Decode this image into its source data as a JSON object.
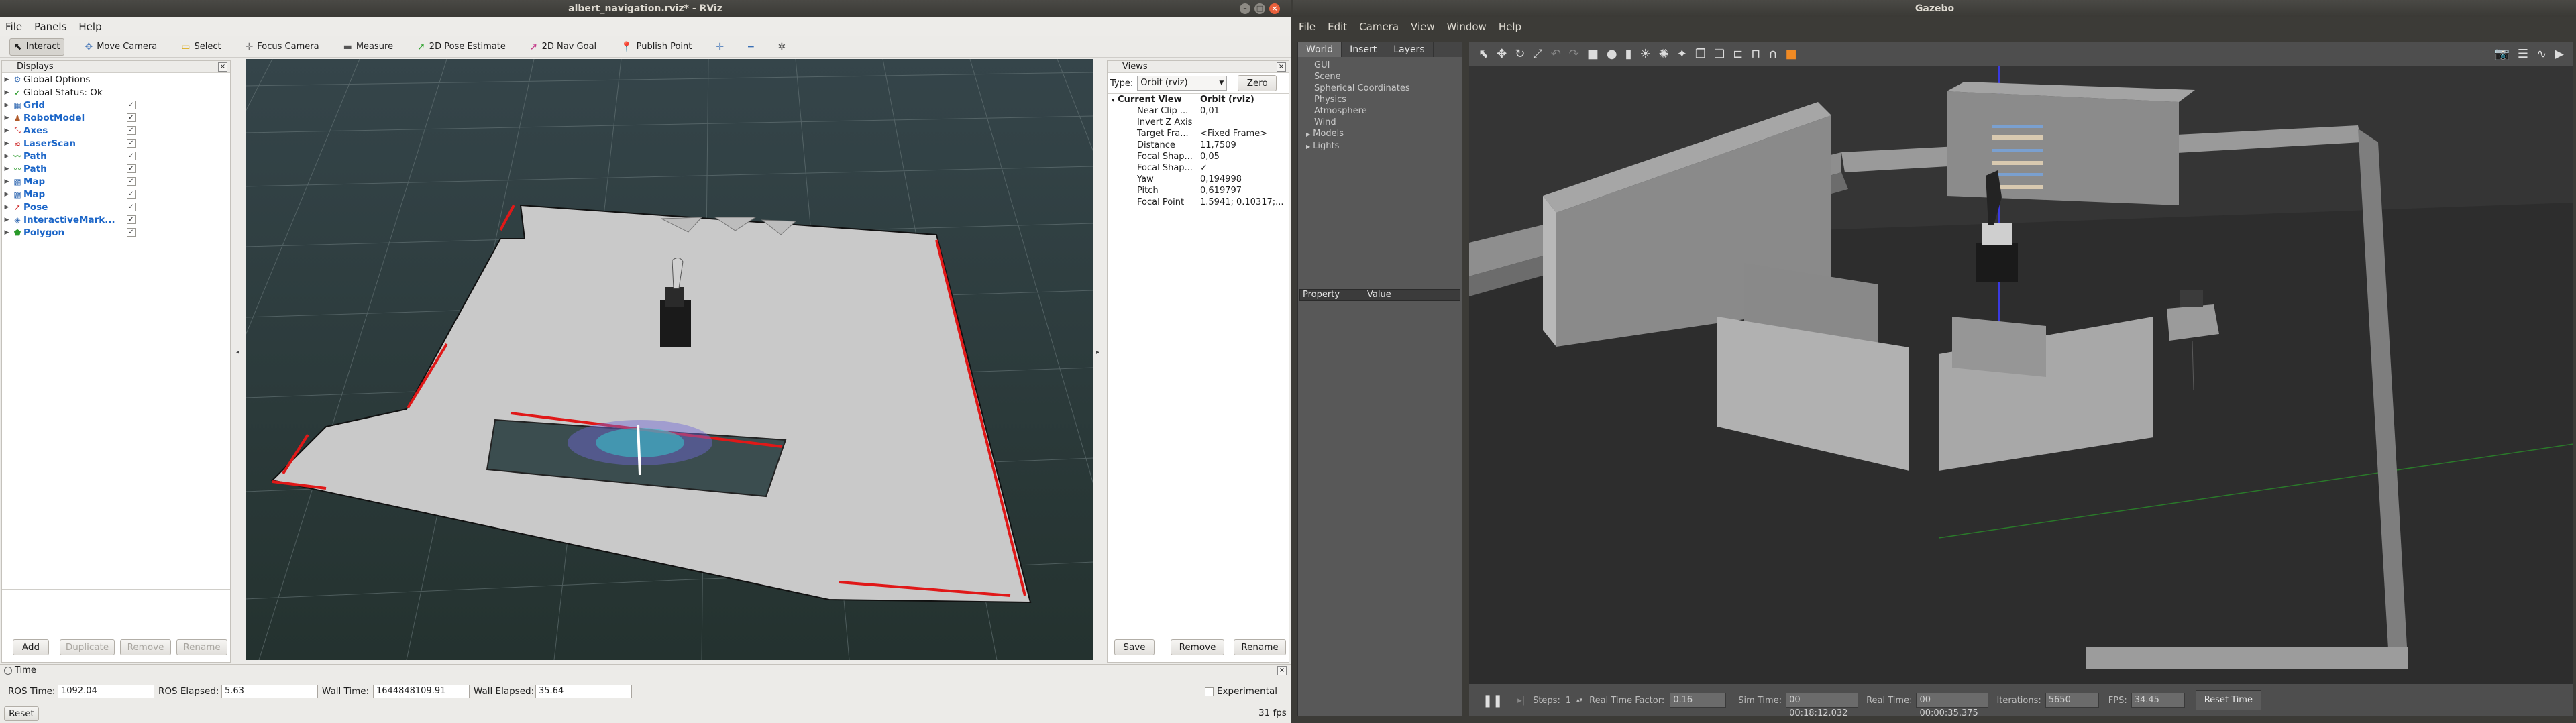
{
  "rviz": {
    "title": "albert_navigation.rviz* - RViz",
    "menu": [
      "File",
      "Panels",
      "Help"
    ],
    "toolbar": [
      {
        "label": "Interact",
        "icon": "interact-icon"
      },
      {
        "label": "Move Camera",
        "icon": "move-camera-icon"
      },
      {
        "label": "Select",
        "icon": "select-icon"
      },
      {
        "label": "Focus Camera",
        "icon": "focus-camera-icon"
      },
      {
        "label": "Measure",
        "icon": "measure-icon"
      },
      {
        "label": "2D Pose Estimate",
        "icon": "pose-estimate-icon"
      },
      {
        "label": "2D Nav Goal",
        "icon": "nav-goal-icon"
      },
      {
        "label": "Publish Point",
        "icon": "publish-point-icon"
      }
    ],
    "displays": {
      "title": "Displays",
      "items": [
        {
          "label": "Global Options",
          "icon": "gear-icon",
          "checked": null,
          "blue": false
        },
        {
          "label": "Global Status: Ok",
          "icon": "check-icon",
          "checked": null,
          "blue": false
        },
        {
          "label": "Grid",
          "icon": "grid-icon",
          "checked": true,
          "blue": true
        },
        {
          "label": "RobotModel",
          "icon": "robot-icon",
          "checked": true,
          "blue": true
        },
        {
          "label": "Axes",
          "icon": "axes-icon",
          "checked": true,
          "blue": true
        },
        {
          "label": "LaserScan",
          "icon": "laser-icon",
          "checked": true,
          "blue": true
        },
        {
          "label": "Path",
          "icon": "path-icon",
          "checked": true,
          "blue": true
        },
        {
          "label": "Path",
          "icon": "path-icon",
          "checked": true,
          "blue": true
        },
        {
          "label": "Map",
          "icon": "map-icon",
          "checked": true,
          "blue": true
        },
        {
          "label": "Map",
          "icon": "map-icon",
          "checked": true,
          "blue": true
        },
        {
          "label": "Pose",
          "icon": "pose-icon",
          "checked": true,
          "blue": true
        },
        {
          "label": "InteractiveMark...",
          "icon": "marker-icon",
          "checked": true,
          "blue": true
        },
        {
          "label": "Polygon",
          "icon": "polygon-icon",
          "checked": true,
          "blue": true
        }
      ],
      "buttons": {
        "add": "Add",
        "duplicate": "Duplicate",
        "remove": "Remove",
        "rename": "Rename"
      }
    },
    "views": {
      "title": "Views",
      "type_label": "Type:",
      "type_value": "Orbit (rviz)",
      "zero_label": "Zero",
      "current_view": {
        "key": "Current View",
        "value": "Orbit (rviz)"
      },
      "properties": [
        {
          "key": "Near Clip ...",
          "value": "0,01"
        },
        {
          "key": "Invert Z Axis",
          "value": ""
        },
        {
          "key": "Target Fra...",
          "value": "<Fixed Frame>"
        },
        {
          "key": "Distance",
          "value": "11,7509"
        },
        {
          "key": "Focal Shap...",
          "value": "0,05"
        },
        {
          "key": "Focal Shap...",
          "value": "✓"
        },
        {
          "key": "Yaw",
          "value": "0,194998"
        },
        {
          "key": "Pitch",
          "value": "0,619797"
        },
        {
          "key": "Focal Point",
          "value": "1.5941; 0.10317;..."
        }
      ],
      "buttons": {
        "save": "Save",
        "remove": "Remove",
        "rename": "Rename"
      }
    },
    "time": {
      "title": "Time",
      "ros_time_label": "ROS Time:",
      "ros_time": "1092.04",
      "ros_elapsed_label": "ROS Elapsed:",
      "ros_elapsed": "5.63",
      "wall_time_label": "Wall Time:",
      "wall_time": "1644848109.91",
      "wall_elapsed_label": "Wall Elapsed:",
      "wall_elapsed": "35.64",
      "experimental_label": "Experimental",
      "reset_label": "Reset",
      "fps": "31 fps"
    }
  },
  "gazebo": {
    "title": "Gazebo",
    "menu": [
      "File",
      "Edit",
      "Camera",
      "View",
      "Window",
      "Help"
    ],
    "tabs": [
      "World",
      "Insert",
      "Layers"
    ],
    "world_items": [
      "GUI",
      "Scene",
      "Spherical Coordinates",
      "Physics",
      "Atmosphere",
      "Wind",
      "Models",
      "Lights"
    ],
    "property_header": {
      "property": "Property",
      "value": "Value"
    },
    "bottom": {
      "steps_label": "Steps:",
      "steps_value": "1",
      "rtf_label": "Real Time Factor:",
      "rtf_value": "0.16",
      "sim_time_label": "Sim Time:",
      "sim_time_value": "00 00:18:12.032",
      "real_time_label": "Real Time:",
      "real_time_value": "00 00:00:35.375",
      "iterations_label": "Iterations:",
      "iterations_value": "5650",
      "fps_label": "FPS:",
      "fps_value": "34.45",
      "reset_label": "Reset Time"
    }
  },
  "colors": {
    "accent_red": "#e8603c",
    "map_gray": "#c6c6c6",
    "grid_bg": "#2c3a3f"
  }
}
